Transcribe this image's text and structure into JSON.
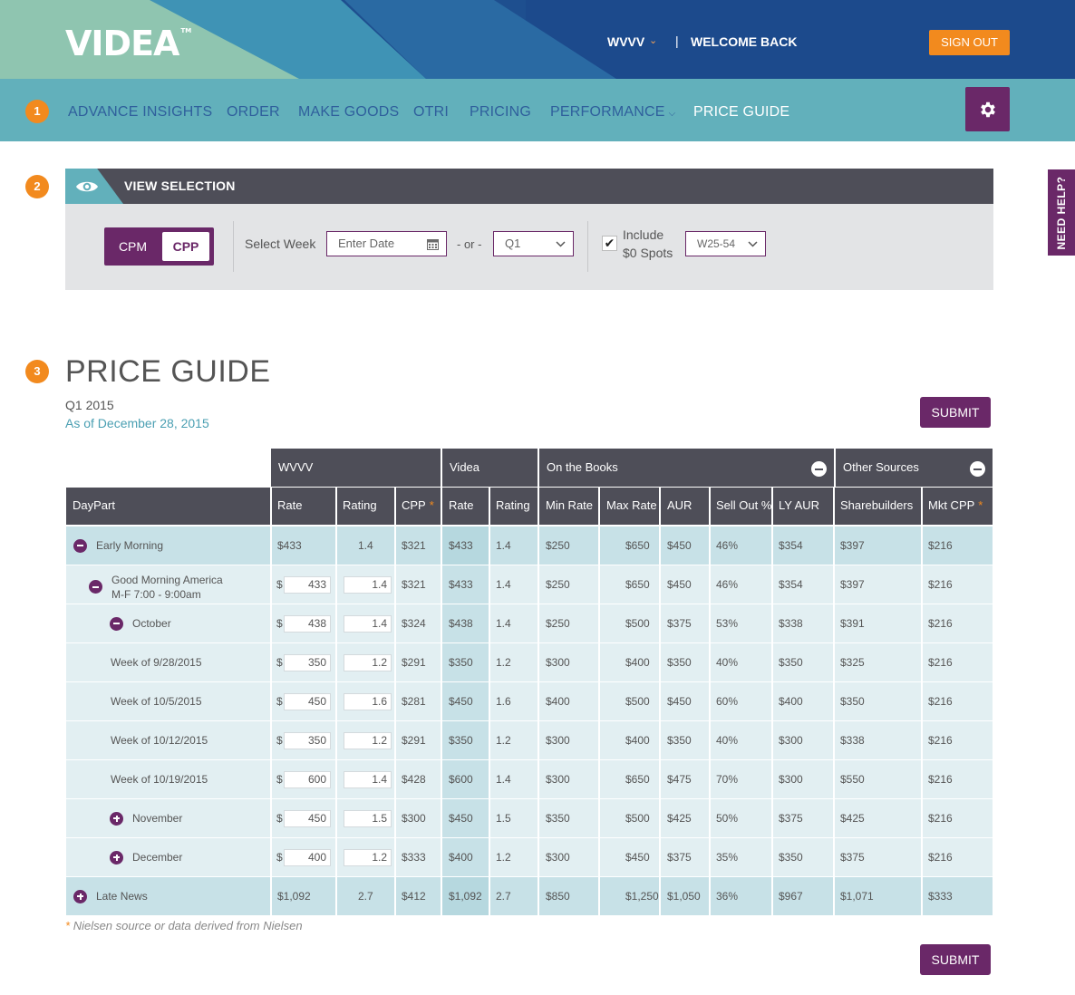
{
  "header": {
    "logo": "VIDEA",
    "logo_tm": "TM",
    "station": "WVVV",
    "pipe": "|",
    "welcome": "WELCOME BACK",
    "sign_out": "SIGN OUT"
  },
  "steps": [
    "1",
    "2",
    "3"
  ],
  "nav": {
    "items": [
      "ADVANCE INSIGHTS",
      "ORDER",
      "MAKE GOODS",
      "OTRI",
      "PRICING",
      "PERFORMANCE",
      "PRICE GUIDE"
    ],
    "active": "PRICE GUIDE",
    "settings_icon": "gear-icon"
  },
  "view_selection": {
    "title": "VIEW SELECTION",
    "toggle": {
      "cpm": "CPM",
      "cpp": "CPP",
      "selected": "CPP"
    },
    "select_week_label": "Select Week",
    "date_placeholder": "Enter Date",
    "or_label": "- or -",
    "quarter_value": "Q1",
    "include_label_1": "Include",
    "include_label_2": "$0 Spots",
    "include_checked": true,
    "demo_value": "W25-54"
  },
  "need_help": "NEED HELP?",
  "price_guide": {
    "title": "PRICE GUIDE",
    "quarter": "Q1 2015",
    "as_of": "As of December 28, 2015",
    "submit": "SUBMIT",
    "group_headers": {
      "wvvv": "WVVV",
      "videa": "Videa",
      "on_books": "On the Books",
      "other": "Other Sources"
    },
    "columns": [
      "DayPart",
      "Rate",
      "Rating",
      "CPP",
      "Rate",
      "Rating",
      "Min Rate",
      "Max Rate",
      "AUR",
      "Sell Out %",
      "LY AUR",
      "Sharebuilders",
      "Mkt CPP"
    ],
    "star": "*",
    "dollar_sign": "$",
    "rows": [
      {
        "name": "Early Morning",
        "icon": "minus",
        "type": "top",
        "editable": false,
        "rate": "$433",
        "rating": "1.4",
        "cpp": "$321",
        "v_rate": "$433",
        "v_rating": "1.4",
        "min": "$250",
        "max": "$650",
        "aur": "$450",
        "sell": "46%",
        "ly": "$354",
        "share": "$397",
        "mkt": "$216"
      },
      {
        "name": "Good Morning America",
        "name2": "M-F 7:00 - 9:00am",
        "icon": "minus",
        "type": "sub",
        "editable": true,
        "rate": "433",
        "rating": "1.4",
        "cpp": "$321",
        "v_rate": "$433",
        "v_rating": "1.4",
        "min": "$250",
        "max": "$650",
        "aur": "$450",
        "sell": "46%",
        "ly": "$354",
        "share": "$397",
        "mkt": "$216"
      },
      {
        "name": "October",
        "icon": "minus",
        "type": "sub",
        "editable": true,
        "rate": "438",
        "rating": "1.4",
        "cpp": "$324",
        "v_rate": "$438",
        "v_rating": "1.4",
        "min": "$250",
        "max": "$500",
        "aur": "$375",
        "sell": "53%",
        "ly": "$338",
        "share": "$391",
        "mkt": "$216"
      },
      {
        "name": "Week of 9/28/2015",
        "icon": "",
        "type": "sub",
        "editable": true,
        "rate": "350",
        "rating": "1.2",
        "cpp": "$291",
        "v_rate": "$350",
        "v_rating": "1.2",
        "min": "$300",
        "max": "$400",
        "aur": "$350",
        "sell": "40%",
        "ly": "$350",
        "share": "$325",
        "mkt": "$216"
      },
      {
        "name": "Week of 10/5/2015",
        "icon": "",
        "type": "sub",
        "editable": true,
        "rate": "450",
        "rating": "1.6",
        "cpp": "$281",
        "v_rate": "$450",
        "v_rating": "1.6",
        "min": "$400",
        "max": "$500",
        "aur": "$450",
        "sell": "60%",
        "ly": "$400",
        "share": "$350",
        "mkt": "$216"
      },
      {
        "name": "Week of 10/12/2015",
        "icon": "",
        "type": "sub",
        "editable": true,
        "rate": "350",
        "rating": "1.2",
        "cpp": "$291",
        "v_rate": "$350",
        "v_rating": "1.2",
        "min": "$300",
        "max": "$400",
        "aur": "$350",
        "sell": "40%",
        "ly": "$300",
        "share": "$338",
        "mkt": "$216"
      },
      {
        "name": "Week of 10/19/2015",
        "icon": "",
        "type": "sub",
        "editable": true,
        "rate": "600",
        "rating": "1.4",
        "cpp": "$428",
        "v_rate": "$600",
        "v_rating": "1.4",
        "min": "$300",
        "max": "$650",
        "aur": "$475",
        "sell": "70%",
        "ly": "$300",
        "share": "$550",
        "mkt": "$216"
      },
      {
        "name": "November",
        "icon": "plus",
        "type": "sub",
        "editable": true,
        "rate": "450",
        "rating": "1.5",
        "cpp": "$300",
        "v_rate": "$450",
        "v_rating": "1.5",
        "min": "$350",
        "max": "$500",
        "aur": "$425",
        "sell": "50%",
        "ly": "$375",
        "share": "$425",
        "mkt": "$216"
      },
      {
        "name": "December",
        "icon": "plus",
        "type": "sub",
        "editable": true,
        "rate": "400",
        "rating": "1.2",
        "cpp": "$333",
        "v_rate": "$400",
        "v_rating": "1.2",
        "min": "$300",
        "max": "$450",
        "aur": "$375",
        "sell": "35%",
        "ly": "$350",
        "share": "$375",
        "mkt": "$216"
      },
      {
        "name": "Late News",
        "icon": "plus",
        "type": "top",
        "editable": false,
        "rate": "$1,092",
        "rating": "2.7",
        "cpp": "$412",
        "v_rate": "$1,092",
        "v_rating": "2.7",
        "min": "$850",
        "max": "$1,250",
        "aur": "$1,050",
        "sell": "36%",
        "ly": "$967",
        "share": "$1,071",
        "mkt": "$333"
      }
    ],
    "footnote_star": "*",
    "footnote": "Nielsen source or data derived from Nielsen"
  },
  "colors": {
    "purple": "#6a2868",
    "orange": "#f28a1e",
    "teal": "#62b0bb",
    "navy": "#1e4f8f",
    "dark_header": "#4e4e58"
  }
}
